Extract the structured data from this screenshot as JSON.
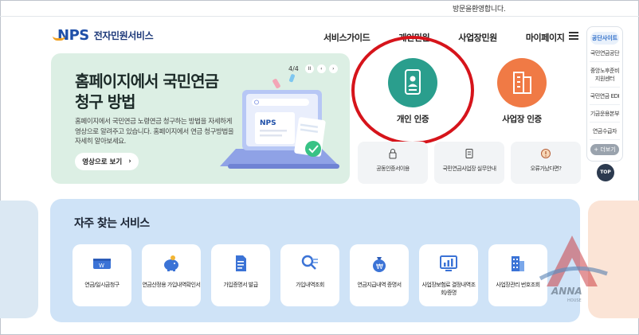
{
  "top_bar": {
    "greeting": "방문을환영합니다."
  },
  "header": {
    "logo_mark": "NPS",
    "logo_text": "전자민원서비스",
    "nav": [
      "서비스가이드",
      "개인민원",
      "사업장민원",
      "마이페이지"
    ]
  },
  "quick_panel": {
    "title": "공단사이트",
    "items": [
      "국민연금공단",
      "중앙노후준비 지원센터",
      "국민연금 EDI",
      "기금운용본부",
      "연금수급자"
    ],
    "more": "+ 더보기",
    "top": "TOP"
  },
  "hero": {
    "title": "홈페이지에서 국민연금 청구 방법",
    "description": "홈페이지에서 국민연금 노령연금 청구하는 방법을 자세하게 영상으로 알려주고 있습니다. 홈페이지에서 연금 청구방법을 자세히 알아보세요.",
    "button": "영상으로 보기",
    "button_arrow": "›",
    "pager": "4/4",
    "pager_pause": "II",
    "pager_prev": "‹",
    "pager_next": "›",
    "art_logo": "NPS"
  },
  "services": {
    "personal": "개인 인증",
    "business": "사업장 인증"
  },
  "mini_cards": [
    {
      "label": "공동인증서이용",
      "icon": "lock-icon"
    },
    {
      "label": "국민연금사업장 실무안내",
      "icon": "document-icon"
    },
    {
      "label": "오류가났다면?",
      "icon": "warning-icon"
    }
  ],
  "frequent": {
    "title": "자주 찾는 서비스",
    "cards": [
      {
        "label": "연금/일시금청구",
        "icon": "won-card-icon"
      },
      {
        "label": "연금산정용 가입내역확인서",
        "icon": "piggy-bank-icon"
      },
      {
        "label": "가입증명서 발급",
        "icon": "document-icon"
      },
      {
        "label": "가입내역조회",
        "icon": "search-list-icon"
      },
      {
        "label": "연금지급내역 증명서",
        "icon": "money-bag-icon"
      },
      {
        "label": "사업장보험료 결정내역조회/증명",
        "icon": "chart-monitor-icon"
      },
      {
        "label": "사업장관리 번호조회",
        "icon": "building-icon"
      }
    ]
  },
  "watermark": {
    "text": "ANNA",
    "subtext": "HOUSE"
  },
  "colors": {
    "brand_blue": "#1e4fa8",
    "hero_bg": "#dcefe4",
    "personal_teal": "#2a9e8d",
    "business_orange": "#f07a45",
    "highlight_red": "#d6141b",
    "frequent_bg": "#cfe3f7"
  }
}
